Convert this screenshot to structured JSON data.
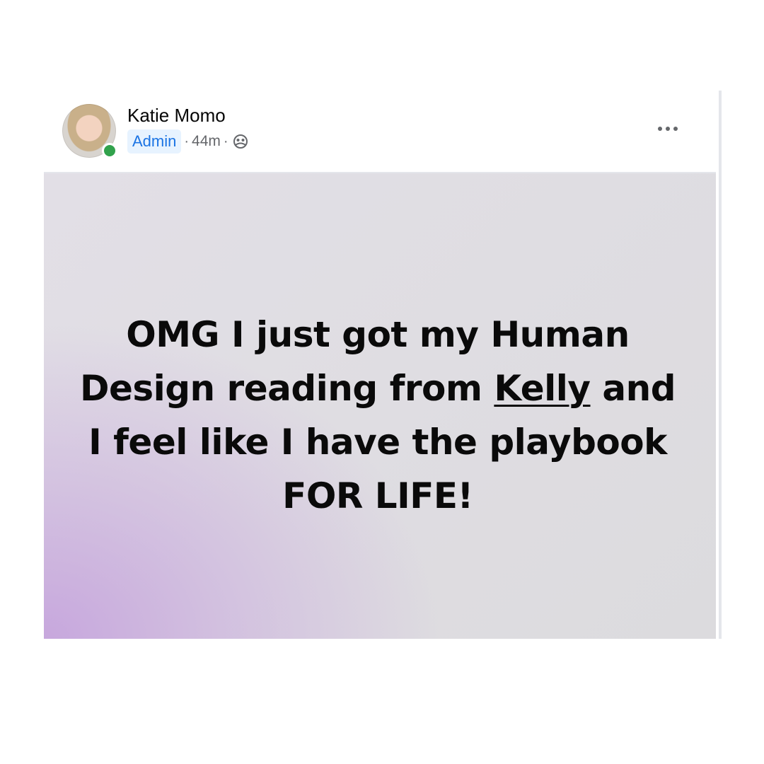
{
  "post": {
    "author": {
      "name": "Katie Momo",
      "role_badge": "Admin",
      "online": true
    },
    "meta": {
      "separator": "·",
      "time_ago": "44m",
      "audience_icon": "group-audience-icon"
    },
    "more_options_icon": "more-options-icon",
    "body": {
      "line1": "OMG I just got my Human",
      "line2_before": "Design reading from ",
      "mention": "Kelly",
      "line2_after": " and",
      "line3": "I feel like I have the playbook",
      "line4": "FOR LIFE!"
    },
    "colors": {
      "badge_bg": "#e7f3ff",
      "badge_text": "#1b74e4",
      "online_dot": "#31a24c",
      "gradient_purple": "#c7a7dd",
      "gradient_grey": "#dcdbde"
    }
  }
}
